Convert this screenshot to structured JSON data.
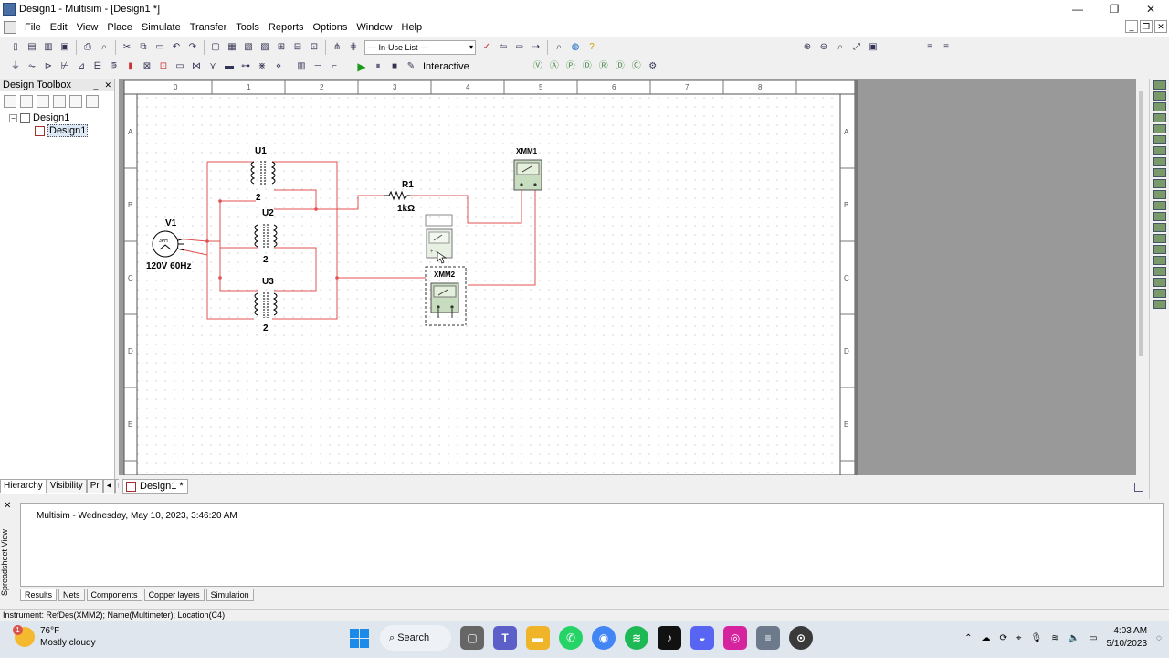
{
  "window": {
    "title": "Design1 - Multisim - [Design1 *]"
  },
  "menu": [
    "File",
    "Edit",
    "View",
    "Place",
    "Simulate",
    "Transfer",
    "Tools",
    "Reports",
    "Options",
    "Window",
    "Help"
  ],
  "toolbar": {
    "in_use_list": "--- In-Use List ---",
    "interactive": "Interactive"
  },
  "toolbox": {
    "title": "Design Toolbox",
    "tree": [
      {
        "label": "Design1"
      },
      {
        "label": "Design1"
      }
    ],
    "tabs": [
      "Hierarchy",
      "Visibility",
      "Pr"
    ]
  },
  "canvas": {
    "ruler_cols": [
      "0",
      "1",
      "2",
      "3",
      "4",
      "5",
      "6",
      "7",
      "8"
    ],
    "ruler_rows": [
      "A",
      "B",
      "C",
      "D",
      "E"
    ],
    "components": {
      "u1": {
        "ref": "U1",
        "value": "2"
      },
      "u2": {
        "ref": "U2",
        "value": "2"
      },
      "u3": {
        "ref": "U3",
        "value": "2"
      },
      "v1": {
        "ref": "V1",
        "value": "120V 60Hz",
        "symbol": "3PH"
      },
      "r1": {
        "ref": "R1",
        "value": "1kΩ"
      },
      "xmm1": {
        "ref": "XMM1"
      },
      "xmm2": {
        "ref": "XMM2"
      }
    },
    "wire_color": "#e05050"
  },
  "doc_tab": {
    "label": "Design1 *"
  },
  "spreadsheet": {
    "side_label": "Spreadsheet View",
    "message": "Multisim  -  Wednesday, May 10, 2023, 3:46:20 AM",
    "tabs": [
      "Results",
      "Nets",
      "Components",
      "Copper layers",
      "Simulation"
    ]
  },
  "status": {
    "text": "Instrument: RefDes(XMM2); Name(Multimeter); Location(C4)"
  },
  "taskbar": {
    "weather_temp": "76°F",
    "weather_desc": "Mostly cloudy",
    "weather_badge": "1",
    "search_label": "Search",
    "time": "4:03 AM",
    "date": "5/10/2023"
  }
}
